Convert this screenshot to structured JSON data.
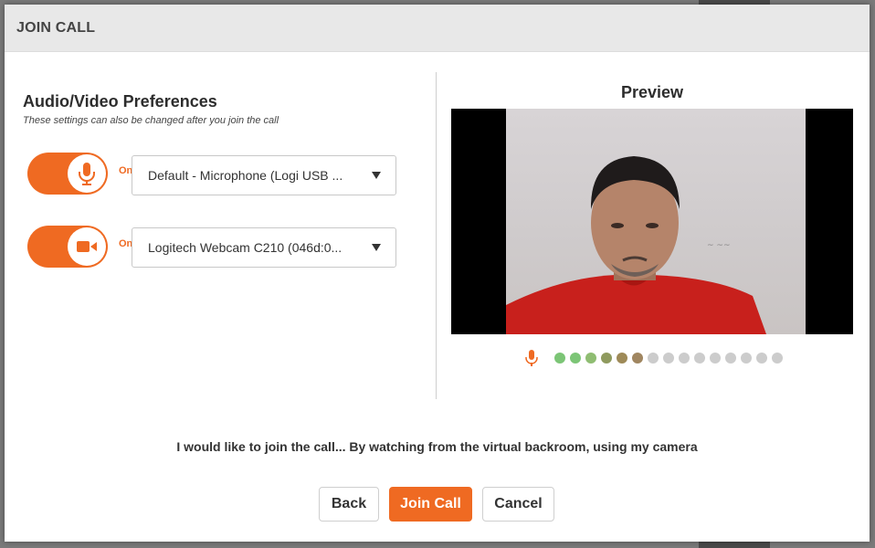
{
  "modal": {
    "title": "JOIN CALL"
  },
  "preferences": {
    "title": "Audio/Video Preferences",
    "subtitle": "These settings can also be changed after you join the call"
  },
  "microphone": {
    "state_label": "On",
    "selected": "Default - Microphone (Logi USB ...",
    "icon": "microphone-icon"
  },
  "camera": {
    "state_label": "On",
    "selected": "Logitech Webcam C210 (046d:0...",
    "icon": "video-camera-icon"
  },
  "preview": {
    "title": "Preview",
    "level_dots": [
      "#7cc576",
      "#7cc576",
      "#8fbd72",
      "#8f9a5e",
      "#9e8a58",
      "#a08660",
      "#cccccc",
      "#cccccc",
      "#cccccc",
      "#cccccc",
      "#cccccc",
      "#cccccc",
      "#cccccc",
      "#cccccc",
      "#cccccc"
    ]
  },
  "join_option_text": "I would like to join the call... By watching from the virtual backroom, using my camera",
  "buttons": {
    "back": "Back",
    "join": "Join Call",
    "cancel": "Cancel"
  },
  "colors": {
    "accent": "#ef6a22",
    "header_bg": "#e8e8e8"
  }
}
